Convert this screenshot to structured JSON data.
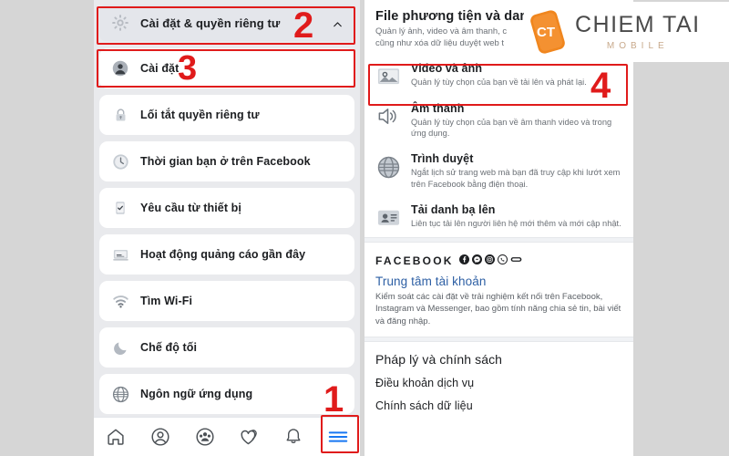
{
  "left_panel": {
    "header": {
      "label": "Cài đặt & quyền riêng tư",
      "icon": "gear-icon",
      "chevron": "chevron-up-icon"
    },
    "items": [
      {
        "label": "Cài đặt",
        "icon": "person-circle-icon"
      },
      {
        "label": "Lối tắt quyền riêng tư",
        "icon": "lock-icon"
      },
      {
        "label": "Thời gian bạn ở trên Facebook",
        "icon": "clock-icon"
      },
      {
        "label": "Yêu cầu từ thiết bị",
        "icon": "device-icon"
      },
      {
        "label": "Hoạt động quảng cáo gần đây",
        "icon": "ad-activity-icon"
      },
      {
        "label": "Tìm Wi-Fi",
        "icon": "wifi-icon"
      },
      {
        "label": "Chế độ tối",
        "icon": "moon-icon"
      },
      {
        "label": "Ngôn ngữ ứng dụng",
        "icon": "globe-icon"
      }
    ],
    "bottom_nav": [
      {
        "name": "home-icon"
      },
      {
        "name": "profile-icon"
      },
      {
        "name": "groups-icon"
      },
      {
        "name": "dating-hearts-icon"
      },
      {
        "name": "bell-icon"
      },
      {
        "name": "hamburger-menu-icon"
      }
    ]
  },
  "right_panel": {
    "section": {
      "title": "File phương tiện và dan",
      "subtitle": "Quản lý ảnh, video và âm thanh, c\ncũng như xóa dữ liệu duyệt web t"
    },
    "rows": [
      {
        "title": "Video và ảnh",
        "desc": "Quản lý tùy chọn của bạn về tải lên và phát lại.",
        "icon": "photo-icon"
      },
      {
        "title": "Âm thanh",
        "desc": "Quản lý tùy chọn của bạn về âm thanh video và trong ứng dụng.",
        "icon": "speaker-icon"
      },
      {
        "title": "Trình duyệt",
        "desc": "Ngắt lịch sử trang web mà bạn đã truy cập khi lướt xem trên Facebook bằng điện thoại.",
        "icon": "browser-globe-icon"
      },
      {
        "title": "Tải danh bạ lên",
        "desc": "Liên tục tải lên người liên hệ mới thêm và mới cập nhật.",
        "icon": "contact-card-icon"
      }
    ],
    "brand": {
      "word": "FACEBOOK",
      "socials": [
        "facebook-icon",
        "messenger-icon",
        "instagram-icon",
        "whatsapp-icon",
        "portal-icon"
      ]
    },
    "account_center": {
      "title": "Trung tâm tài khoản",
      "desc": "Kiểm soát các cài đặt về trải nghiệm kết nối trên Facebook, Instagram và Messenger, bao gồm tính năng chia sẻ tin, bài viết và đăng nhập."
    },
    "legal": {
      "heading": "Pháp lý và chính sách",
      "items": [
        "Điều khoản dịch vụ",
        "Chính sách dữ liệu"
      ]
    }
  },
  "annotations": {
    "step1": "1",
    "step2": "2",
    "step3": "3",
    "step4": "4",
    "highlight_color": "#e01b1b"
  },
  "watermark": {
    "brand_main": "CHIEM TAI",
    "brand_sub": "MOBILE",
    "mark_text": "CT",
    "mark_color": "#f0861e"
  }
}
